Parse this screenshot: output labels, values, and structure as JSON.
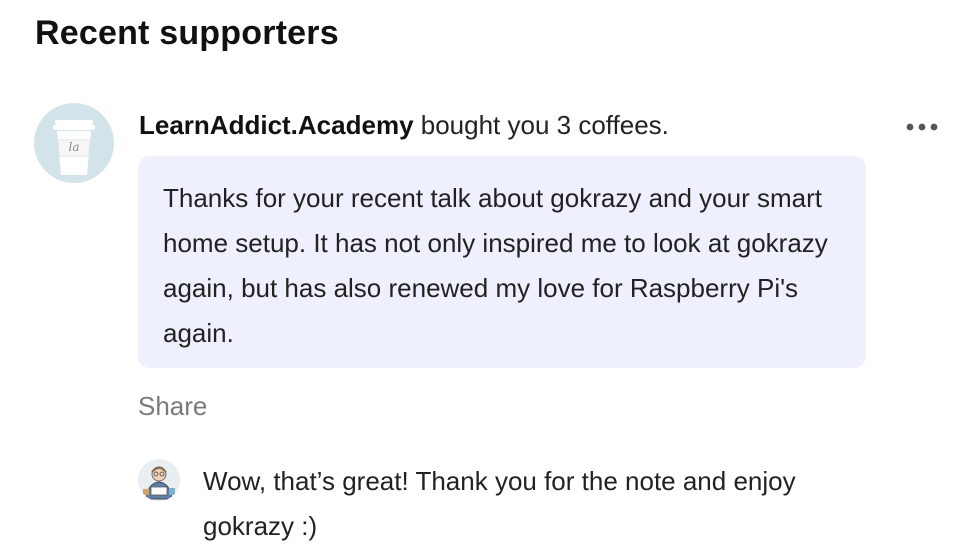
{
  "section": {
    "title": "Recent supporters"
  },
  "supporter": {
    "avatar_icon": "coffee-cup-icon",
    "avatar_text": "la",
    "name": "LearnAddict.Academy",
    "action": " bought you 3 coffees.",
    "more_icon": "more-horizontal-icon",
    "message": "Thanks for your recent talk about gokrazy and your smart home setup. It has not only inspired me to look at gokrazy again, but has also renewed my love for Raspberry Pi's again.",
    "share_label": "Share"
  },
  "reply": {
    "avatar_icon": "creator-avatar-icon",
    "text": "Wow, that’s great! Thank you for the note and enjoy gokrazy :)"
  },
  "colors": {
    "bubble_background": "#eff0fd",
    "avatar_background": "#d3e3ea",
    "muted_text": "#7a7a7a"
  }
}
